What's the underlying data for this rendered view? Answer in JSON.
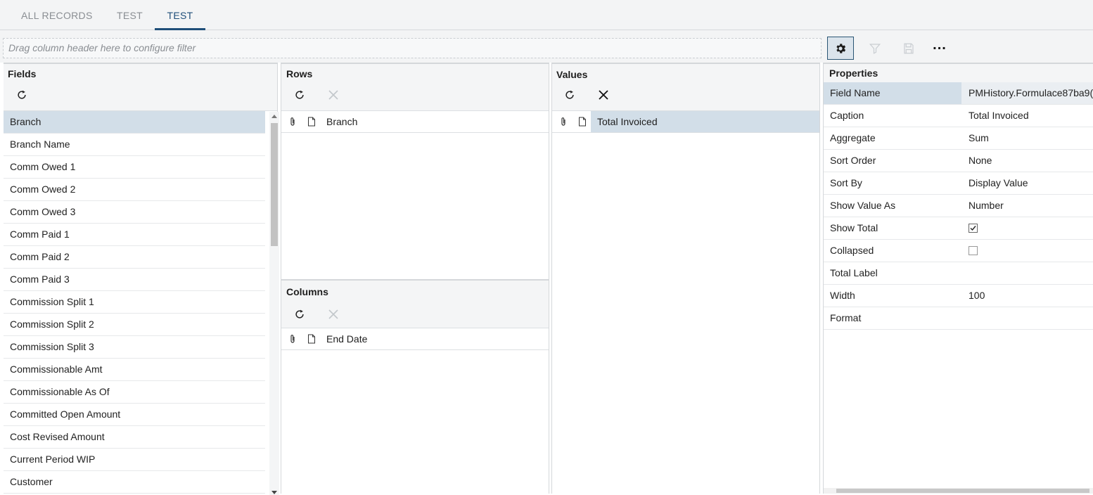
{
  "tabs": [
    {
      "label": "ALL RECORDS",
      "active": false
    },
    {
      "label": "TEST",
      "active": false
    },
    {
      "label": "TEST",
      "active": true
    }
  ],
  "filter": {
    "placeholder": "Drag column header here to configure filter"
  },
  "toolbar": {
    "settings_icon": "gear-icon",
    "filter_icon": "filter-icon",
    "save_icon": "save-icon",
    "more_label": "..."
  },
  "fields_panel": {
    "title": "Fields",
    "items": [
      "Branch",
      "Branch Name",
      "Comm Owed 1",
      "Comm Owed 2",
      "Comm Owed 3",
      "Comm Paid 1",
      "Comm Paid 2",
      "Comm Paid 3",
      "Commission Split 1",
      "Commission Split 2",
      "Commission Split 3",
      "Commissionable Amt",
      "Commissionable As Of",
      "Committed Open Amount",
      "Cost Revised Amount",
      "Current Period WIP",
      "Customer"
    ],
    "selected_index": 0
  },
  "rows_panel": {
    "title": "Rows",
    "items": [
      "Branch"
    ]
  },
  "columns_panel": {
    "title": "Columns",
    "items": [
      "End Date"
    ]
  },
  "values_panel": {
    "title": "Values",
    "items": [
      "Total Invoiced"
    ]
  },
  "properties": {
    "title": "Properties",
    "rows": [
      {
        "name": "Field Name",
        "value": "PMHistory.Formulace87ba9(",
        "type": "text",
        "selected": true
      },
      {
        "name": "Caption",
        "value": "Total Invoiced",
        "type": "text"
      },
      {
        "name": "Aggregate",
        "value": "Sum",
        "type": "text"
      },
      {
        "name": "Sort Order",
        "value": "None",
        "type": "text"
      },
      {
        "name": "Sort By",
        "value": "Display Value",
        "type": "text"
      },
      {
        "name": "Show Value As",
        "value": "Number",
        "type": "text"
      },
      {
        "name": "Show Total",
        "value": true,
        "type": "checkbox"
      },
      {
        "name": "Collapsed",
        "value": false,
        "type": "checkbox"
      },
      {
        "name": "Total Label",
        "value": "",
        "type": "text"
      },
      {
        "name": "Width",
        "value": "100",
        "type": "text"
      },
      {
        "name": "Format",
        "value": "",
        "type": "text"
      }
    ]
  },
  "colors": {
    "accent": "#1f4e79",
    "selected_row": "#d2dee8",
    "header_bg": "#f4f5f6"
  }
}
